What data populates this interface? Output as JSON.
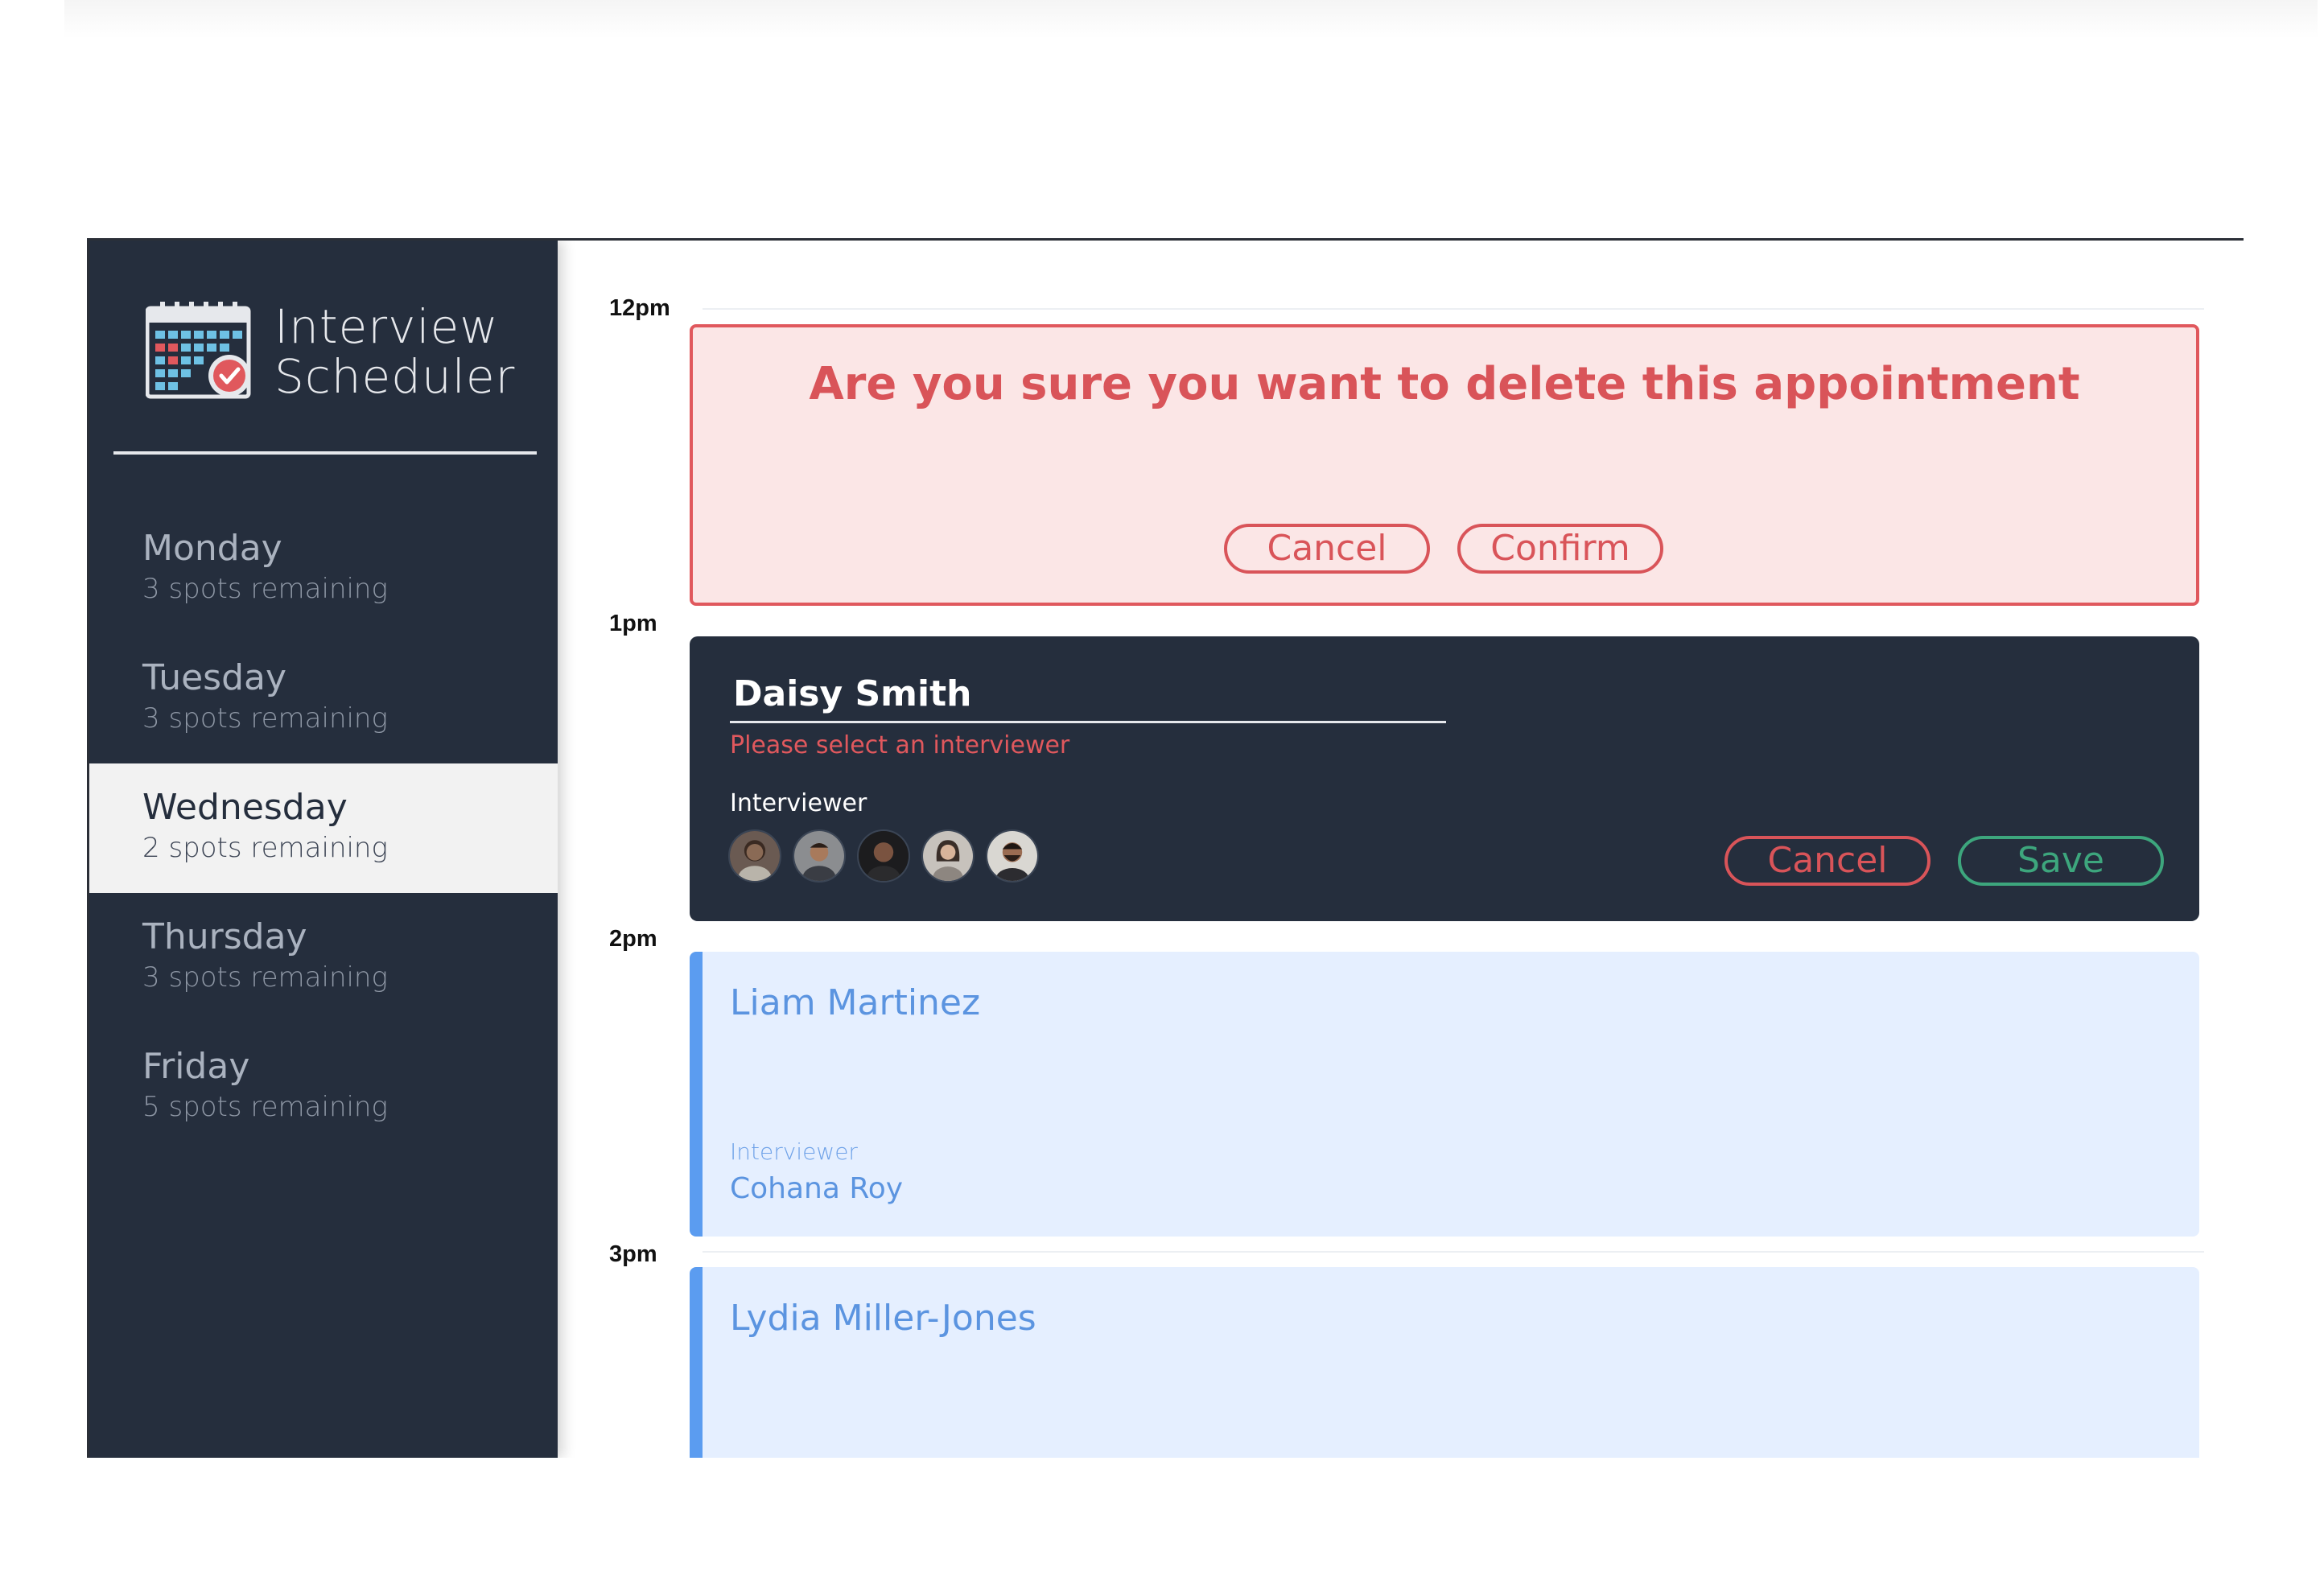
{
  "app": {
    "title_line1": "Interview",
    "title_line2": "Scheduler"
  },
  "days": [
    {
      "name": "Monday",
      "spots": "3 spots remaining",
      "selected": false
    },
    {
      "name": "Tuesday",
      "spots": "3 spots remaining",
      "selected": false
    },
    {
      "name": "Wednesday",
      "spots": "2 spots remaining",
      "selected": true
    },
    {
      "name": "Thursday",
      "spots": "3 spots remaining",
      "selected": false
    },
    {
      "name": "Friday",
      "spots": "5 spots remaining",
      "selected": false
    }
  ],
  "times": [
    "12pm",
    "1pm",
    "2pm",
    "3pm"
  ],
  "confirm": {
    "message": "Are you sure you want to delete this appointment",
    "cancel_label": "Cancel",
    "confirm_label": "Confirm"
  },
  "form": {
    "student_name": "Daisy Smith",
    "error": "Please select an interviewer",
    "interviewer_label": "Interviewer",
    "interviewer_count": 5,
    "cancel_label": "Cancel",
    "save_label": "Save"
  },
  "appointments": [
    {
      "student": "Liam Martinez",
      "interviewer_label": "Interviewer",
      "interviewer": "Cohana Roy"
    },
    {
      "student": "Lydia Miller-Jones"
    }
  ],
  "colors": {
    "sidebar": "#252e3d",
    "danger": "#d95459",
    "success": "#3da67d",
    "appointment": "#5b94e0",
    "appointment_bg": "#e5efff"
  },
  "icons": {
    "brand": "calendar-check-icon",
    "avatars": "interviewer-avatar-icon"
  }
}
